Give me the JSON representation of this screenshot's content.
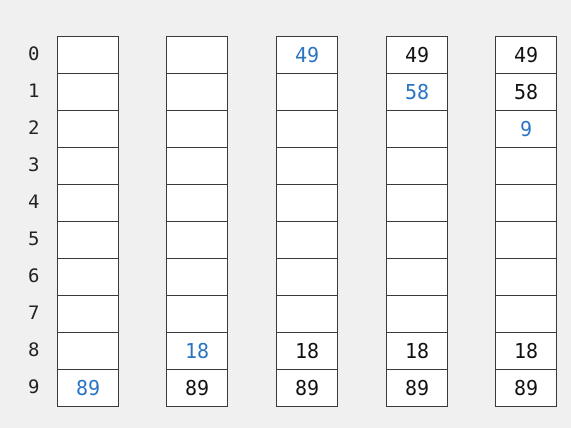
{
  "row_indices": [
    "0",
    "1",
    "2",
    "3",
    "4",
    "5",
    "6",
    "7",
    "8",
    "9"
  ],
  "colors": {
    "new_value": "#2a74c4",
    "existing_value": "#111111"
  },
  "tables": [
    {
      "cells": [
        {
          "value": ""
        },
        {
          "value": ""
        },
        {
          "value": ""
        },
        {
          "value": ""
        },
        {
          "value": ""
        },
        {
          "value": ""
        },
        {
          "value": ""
        },
        {
          "value": ""
        },
        {
          "value": ""
        },
        {
          "value": "89",
          "new": true
        }
      ]
    },
    {
      "cells": [
        {
          "value": ""
        },
        {
          "value": ""
        },
        {
          "value": ""
        },
        {
          "value": ""
        },
        {
          "value": ""
        },
        {
          "value": ""
        },
        {
          "value": ""
        },
        {
          "value": ""
        },
        {
          "value": "18",
          "new": true
        },
        {
          "value": "89"
        }
      ]
    },
    {
      "cells": [
        {
          "value": "49",
          "new": true
        },
        {
          "value": ""
        },
        {
          "value": ""
        },
        {
          "value": ""
        },
        {
          "value": ""
        },
        {
          "value": ""
        },
        {
          "value": ""
        },
        {
          "value": ""
        },
        {
          "value": "18"
        },
        {
          "value": "89"
        }
      ]
    },
    {
      "cells": [
        {
          "value": "49"
        },
        {
          "value": "58",
          "new": true
        },
        {
          "value": ""
        },
        {
          "value": ""
        },
        {
          "value": ""
        },
        {
          "value": ""
        },
        {
          "value": ""
        },
        {
          "value": ""
        },
        {
          "value": "18"
        },
        {
          "value": "89"
        }
      ]
    },
    {
      "cells": [
        {
          "value": "49"
        },
        {
          "value": "58"
        },
        {
          "value": "9",
          "new": true
        },
        {
          "value": ""
        },
        {
          "value": ""
        },
        {
          "value": ""
        },
        {
          "value": ""
        },
        {
          "value": ""
        },
        {
          "value": "18"
        },
        {
          "value": "89"
        }
      ]
    }
  ]
}
